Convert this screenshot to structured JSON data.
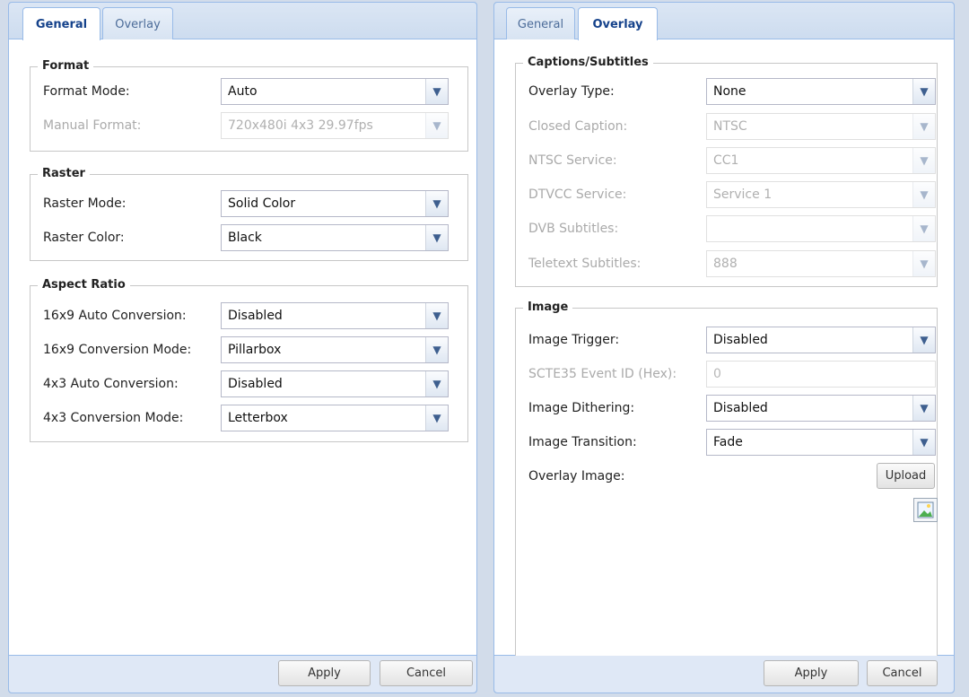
{
  "left_panel": {
    "tabs": [
      {
        "label": "General",
        "active": true
      },
      {
        "label": "Overlay",
        "active": false
      }
    ],
    "format": {
      "legend": "Format",
      "format_mode": {
        "label": "Format Mode:",
        "value": "Auto"
      },
      "manual_format": {
        "label": "Manual Format:",
        "value": "720x480i 4x3 29.97fps",
        "disabled": true
      }
    },
    "raster": {
      "legend": "Raster",
      "raster_mode": {
        "label": "Raster Mode:",
        "value": "Solid Color"
      },
      "raster_color": {
        "label": "Raster Color:",
        "value": "Black"
      }
    },
    "aspect_ratio": {
      "legend": "Aspect Ratio",
      "auto_16x9": {
        "label": "16x9 Auto Conversion:",
        "value": "Disabled"
      },
      "mode_16x9": {
        "label": "16x9 Conversion Mode:",
        "value": "Pillarbox"
      },
      "auto_4x3": {
        "label": "4x3 Auto Conversion:",
        "value": "Disabled"
      },
      "mode_4x3": {
        "label": "4x3 Conversion Mode:",
        "value": "Letterbox"
      }
    },
    "footer": {
      "apply": "Apply",
      "cancel": "Cancel"
    }
  },
  "right_panel": {
    "tabs": [
      {
        "label": "General",
        "active": false
      },
      {
        "label": "Overlay",
        "active": true
      }
    ],
    "captions": {
      "legend": "Captions/Subtitles",
      "overlay_type": {
        "label": "Overlay Type:",
        "value": "None"
      },
      "closed_caption": {
        "label": "Closed Caption:",
        "value": "NTSC",
        "disabled": true
      },
      "ntsc_service": {
        "label": "NTSC Service:",
        "value": "CC1",
        "disabled": true
      },
      "dtvcc_service": {
        "label": "DTVCC Service:",
        "value": "Service 1",
        "disabled": true
      },
      "dvb_subtitles": {
        "label": "DVB Subtitles:",
        "value": "",
        "disabled": true
      },
      "teletext_subtitles": {
        "label": "Teletext Subtitles:",
        "value": "888",
        "disabled": true
      }
    },
    "image": {
      "legend": "Image",
      "image_trigger": {
        "label": "Image Trigger:",
        "value": "Disabled"
      },
      "scte35_event_id": {
        "label": "SCTE35 Event ID (Hex):",
        "value": "0",
        "disabled": true
      },
      "image_dithering": {
        "label": "Image Dithering:",
        "value": "Disabled"
      },
      "image_transition": {
        "label": "Image Transition:",
        "value": "Fade"
      },
      "overlay_image": {
        "label": "Overlay Image:",
        "upload_label": "Upload"
      }
    },
    "footer": {
      "apply": "Apply",
      "cancel": "Cancel"
    }
  },
  "icons": {
    "dropdown_trigger": "chevron-down-icon",
    "image_placeholder": "broken-image-icon"
  },
  "colors": {
    "panel_border": "#99bbe8",
    "tab_active_text": "#15428b",
    "disabled_text": "#aaaaaa"
  }
}
